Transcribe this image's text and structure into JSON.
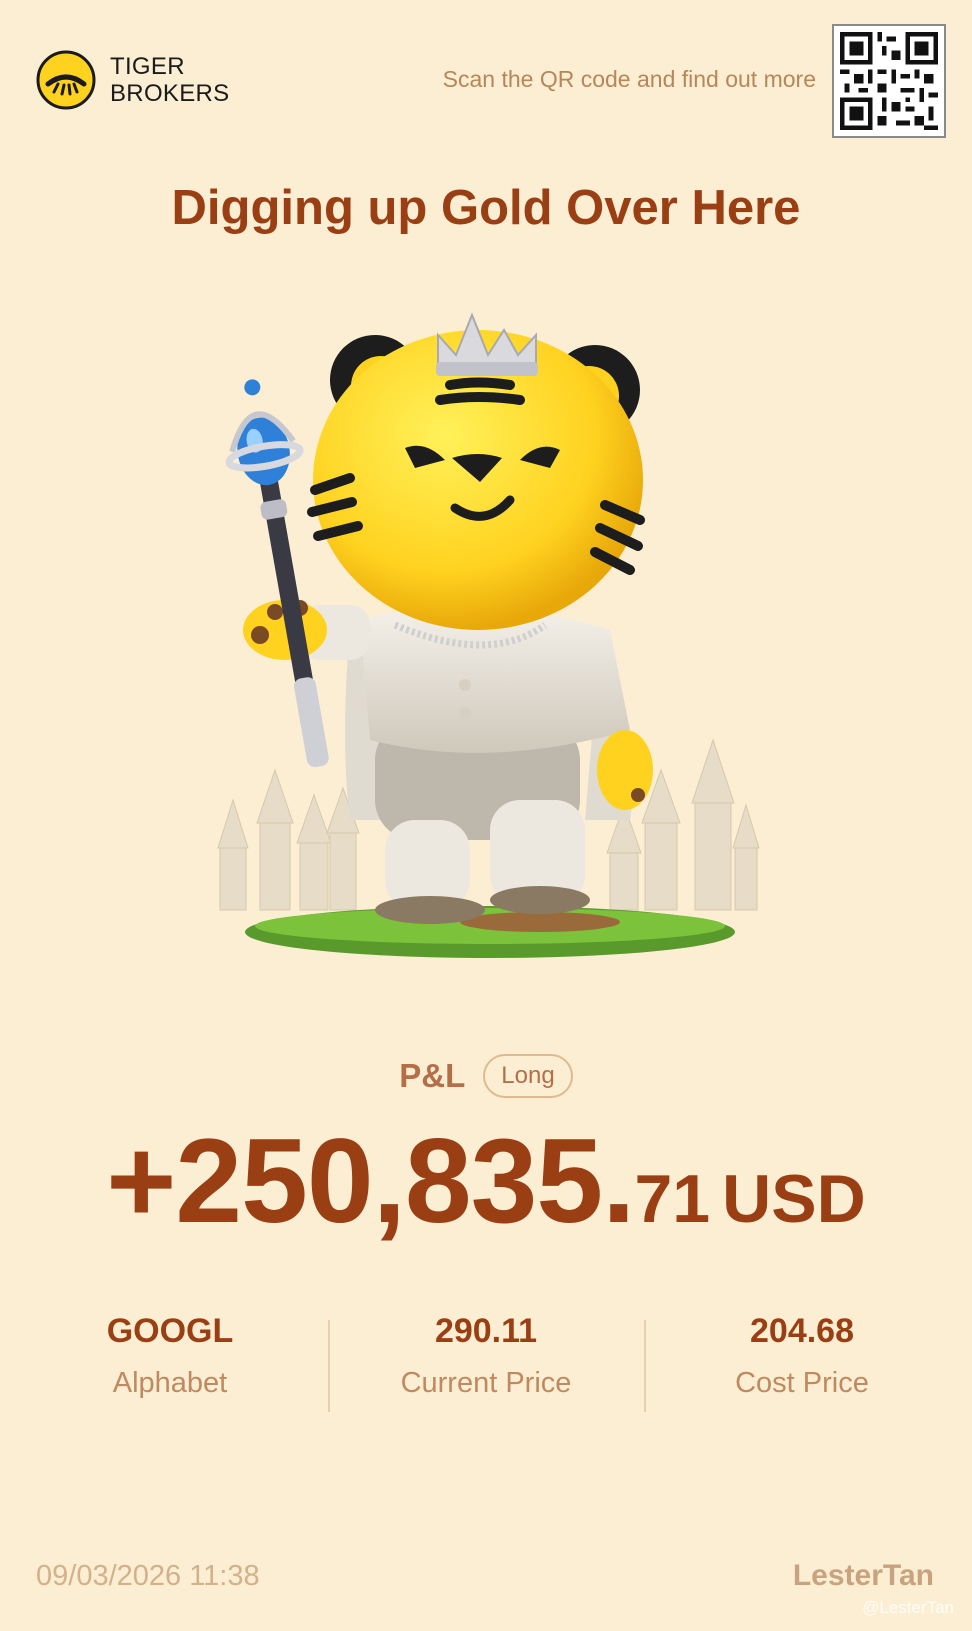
{
  "header": {
    "brand_line1": "TIGER",
    "brand_line2": "BROKERS",
    "scan_text": "Scan the QR code and find out more",
    "logo_icon": "tiger-logo-icon",
    "qr_icon": "qr-code-icon"
  },
  "title": "Digging up Gold Over Here",
  "pnl": {
    "label": "P&L",
    "position_type": "Long",
    "amount_main": "+250,835.",
    "amount_decimal": "71",
    "currency": "USD"
  },
  "stats": [
    {
      "value": "GOOGL",
      "label": "Alphabet"
    },
    {
      "value": "290.11",
      "label": "Current Price"
    },
    {
      "value": "204.68",
      "label": "Cost Price"
    }
  ],
  "footer": {
    "timestamp": "09/03/2026 11:38",
    "username": "LesterTan",
    "watermark": "@LesterTan"
  },
  "colors": {
    "background": "#fbeed3",
    "accent": "#9a3e14",
    "muted": "#c08a60",
    "tiger_yellow": "#ffd21f"
  }
}
